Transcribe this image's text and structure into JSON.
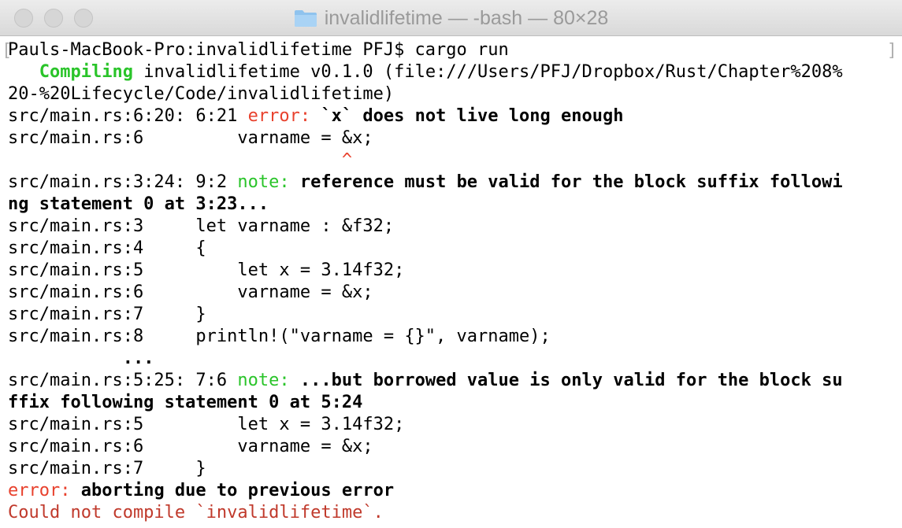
{
  "window": {
    "title": "invalidlifetime — -bash — 80×28",
    "title_icon": "folder-icon",
    "colors": {
      "green": "#2ac42a",
      "red": "#e8412d",
      "folder": "#8fc3ee"
    }
  },
  "terminal": {
    "prompt": "Pauls-MacBook-Pro:invalidlifetime PFJ$ cargo run",
    "compiling_label": "Compiling",
    "compiling_text": " invalidlifetime v0.1.0 (file:///Users/PFJ/Dropbox/Rust/Chapter%208%",
    "compiling_cont": "20-%20Lifecycle/Code/invalidlifetime)",
    "err1_prefix": "src/main.rs:6:20: 6:21 ",
    "err1_label": "error:",
    "err1_msg": " `x` does not live long enough",
    "err1_src": "src/main.rs:6         varname = &x;",
    "err1_caret": "^",
    "note1_prefix": "src/main.rs:3:24: 9:2 ",
    "note1_label": "note:",
    "note1_msg": " reference must be valid for the block suffix followi",
    "note1_cont": "ng statement 0 at 3:23...",
    "code1": [
      "src/main.rs:3     let varname : &f32;",
      "src/main.rs:4     {",
      "src/main.rs:5         let x = 3.14f32;",
      "src/main.rs:6         varname = &x;",
      "src/main.rs:7     }",
      "src/main.rs:8     println!(\"varname = {}\", varname);"
    ],
    "ellipsis": "...",
    "note2_prefix": "src/main.rs:5:25: 7:6 ",
    "note2_label": "note:",
    "note2_msg": " ...but borrowed value is only valid for the block su",
    "note2_cont": "ffix following statement 0 at 5:24",
    "code2": [
      "src/main.rs:5         let x = 3.14f32;",
      "src/main.rs:6         varname = &x;",
      "src/main.rs:7     }"
    ],
    "final_label": "error:",
    "final_msg": " aborting due to previous error",
    "could_not": "Could not compile `invalidlifetime`."
  }
}
